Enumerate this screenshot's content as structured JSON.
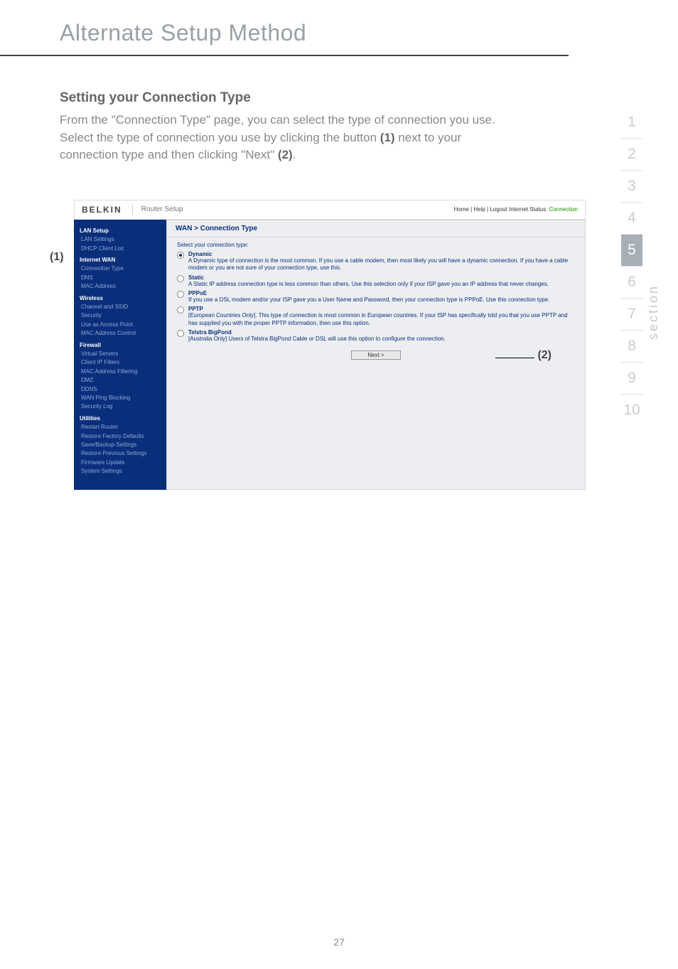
{
  "page": {
    "title": "Alternate Setup Method",
    "number": "27"
  },
  "section_nav": {
    "items": [
      "1",
      "2",
      "3",
      "4",
      "5",
      "6",
      "7",
      "8",
      "9",
      "10"
    ],
    "active_index": 4,
    "label": "section"
  },
  "content": {
    "heading": "Setting your Connection Type",
    "para_pre": "From the \"Connection Type\" page, you can select the type of connection you use. Select the type of connection you use by clicking the button ",
    "bold1": "(1)",
    "para_mid": " next to your connection type and then clicking \"Next\" ",
    "bold2": "(2)",
    "para_end": "."
  },
  "annotations": {
    "one": "(1)",
    "two": "(2)"
  },
  "router": {
    "logo": "BELKIN",
    "setup_label": "Router Setup",
    "status_links": "Home | Help | Logout   Internet Status: ",
    "status_value": "Connection",
    "main_title": "WAN > Connection Type",
    "prompt": "Select your connection type:",
    "next_label": "Next >",
    "sidebar": [
      {
        "type": "hdr",
        "text": "LAN Setup"
      },
      {
        "type": "item",
        "text": "LAN Settings"
      },
      {
        "type": "item",
        "text": "DHCP Client List"
      },
      {
        "type": "hdr",
        "text": "Internet WAN"
      },
      {
        "type": "item",
        "text": "Connection Type"
      },
      {
        "type": "item",
        "text": "DNS"
      },
      {
        "type": "item",
        "text": "MAC Address"
      },
      {
        "type": "hdr",
        "text": "Wireless"
      },
      {
        "type": "item",
        "text": "Channel and SSID"
      },
      {
        "type": "item",
        "text": "Security"
      },
      {
        "type": "item",
        "text": "Use as Access Point"
      },
      {
        "type": "item",
        "text": "MAC Address Control"
      },
      {
        "type": "hdr",
        "text": "Firewall"
      },
      {
        "type": "item",
        "text": "Virtual Servers"
      },
      {
        "type": "item",
        "text": "Client IP Filters"
      },
      {
        "type": "item",
        "text": "MAC Address Filtering"
      },
      {
        "type": "item",
        "text": "DMZ"
      },
      {
        "type": "item",
        "text": "DDNS"
      },
      {
        "type": "item",
        "text": "WAN Ping Blocking"
      },
      {
        "type": "item",
        "text": "Security Log"
      },
      {
        "type": "hdr",
        "text": "Utilities"
      },
      {
        "type": "item",
        "text": "Restart Router"
      },
      {
        "type": "item",
        "text": "Restore Factory Defaults"
      },
      {
        "type": "item",
        "text": "Save/Backup Settings"
      },
      {
        "type": "item",
        "text": "Restore Previous Settings"
      },
      {
        "type": "item",
        "text": "Firmware Update"
      },
      {
        "type": "item",
        "text": "System Settings"
      }
    ],
    "options": [
      {
        "name": "Dynamic",
        "selected": true,
        "desc": "A Dynamic type of connection is the most common. If you use a cable modem, then most likely you will have a dynamic connection. If you have a cable modem or you are not sure of your connection type, use this."
      },
      {
        "name": "Static",
        "selected": false,
        "desc": "A Static IP address connection type is less common than others. Use this selection only if your ISP gave you an IP address that never changes."
      },
      {
        "name": "PPPoE",
        "selected": false,
        "desc": "If you use a DSL modem and/or your ISP gave you a User Name and Password, then your connection type is PPPoE. Use this connection type."
      },
      {
        "name": "PPTP",
        "selected": false,
        "desc": "[European Countries Only]. This type of connection is most common in European countries. If your ISP has specifically told you that you use PPTP and has supplied you with the proper PPTP information, then use this option."
      },
      {
        "name": "Telstra BigPond",
        "selected": false,
        "desc": "[Australia Only] Users of Telstra BigPond Cable or DSL will use this option to configure the connection."
      }
    ]
  }
}
